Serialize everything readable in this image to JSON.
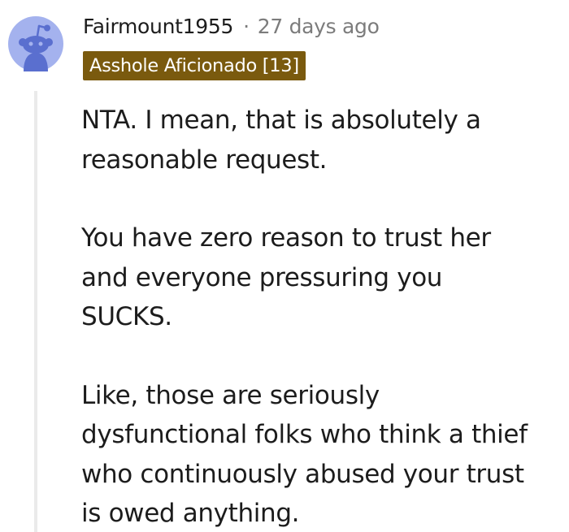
{
  "comment": {
    "username": "Fairmount1955",
    "separator": "·",
    "timestamp": "27 days ago",
    "flair": "Asshole Aficionado [13]",
    "avatar_icon": "reddit-snoo-avatar",
    "paragraphs": [
      [
        "NTA. I mean, that is absolutely a",
        "reasonable request."
      ],
      [
        "You have zero reason to trust her",
        "and everyone pressuring you",
        "SUCKS."
      ],
      [
        "Like, those are seriously",
        "dysfunctional folks who think a thief",
        "who continuously abused your trust",
        "is owed anything."
      ]
    ]
  },
  "colors": {
    "flair_background": "#7a5a0e",
    "avatar_background": "#a4b2ee",
    "avatar_figure": "#5a6fcf",
    "thread_line": "#eaeaea",
    "text": "#1c1c1c",
    "meta_text": "#7c7c7c"
  }
}
